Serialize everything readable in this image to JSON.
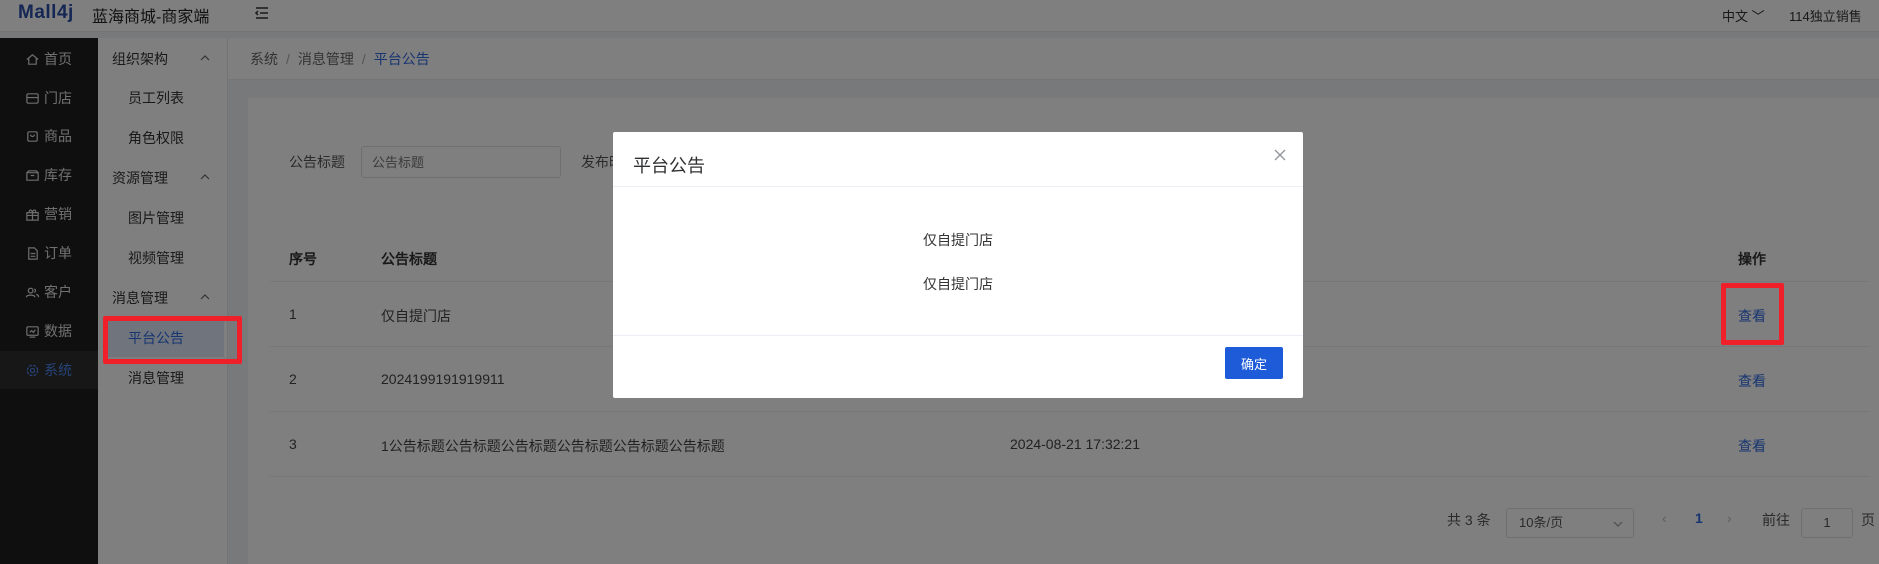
{
  "header": {
    "logo": "Mall4j",
    "brand": "蓝海商城-商家端",
    "language": "中文",
    "user": "114独立销售"
  },
  "sidebar": {
    "items": [
      {
        "label": "首页",
        "icon": "home-icon"
      },
      {
        "label": "门店",
        "icon": "store-icon"
      },
      {
        "label": "商品",
        "icon": "bag-icon"
      },
      {
        "label": "库存",
        "icon": "inventory-icon"
      },
      {
        "label": "营销",
        "icon": "gift-icon"
      },
      {
        "label": "订单",
        "icon": "order-icon"
      },
      {
        "label": "客户",
        "icon": "users-icon"
      },
      {
        "label": "数据",
        "icon": "chart-icon"
      },
      {
        "label": "系统",
        "icon": "gear-icon"
      }
    ],
    "active": "系统"
  },
  "submenu": {
    "groups": [
      {
        "label": "组织架构",
        "items": [
          "员工列表",
          "角色权限"
        ]
      },
      {
        "label": "资源管理",
        "items": [
          "图片管理",
          "视频管理"
        ]
      },
      {
        "label": "消息管理",
        "items": [
          "平台公告",
          "消息管理"
        ]
      }
    ],
    "active": "平台公告"
  },
  "breadcrumb": [
    "系统",
    "消息管理",
    "平台公告"
  ],
  "search": {
    "title_label": "公告标题",
    "title_placeholder": "公告标题",
    "publish_label": "发布时"
  },
  "table": {
    "headers": {
      "index": "序号",
      "title": "公告标题",
      "action": "操作"
    },
    "rows": [
      {
        "index": "1",
        "title": "仅自提门店",
        "time": "",
        "action": "查看"
      },
      {
        "index": "2",
        "title": "2024199191919911",
        "time": "",
        "action": "查看"
      },
      {
        "index": "3",
        "title": "1公告标题公告标题公告标题公告标题公告标题公告标题",
        "time": "2024-08-21 17:32:21",
        "action": "查看"
      }
    ]
  },
  "pagination": {
    "total": "共 3 条",
    "page_size": "10条/页",
    "current_page": "1",
    "goto_label": "前往",
    "goto_value": "1",
    "page_suffix": "页"
  },
  "dialog": {
    "title": "平台公告",
    "line1": "仅自提门店",
    "line2": "仅自提门店",
    "confirm": "确定"
  },
  "colors": {
    "accent": "#1d5bd8",
    "highlight": "#f0202a",
    "sidebar_bg": "#1f1f1f"
  }
}
